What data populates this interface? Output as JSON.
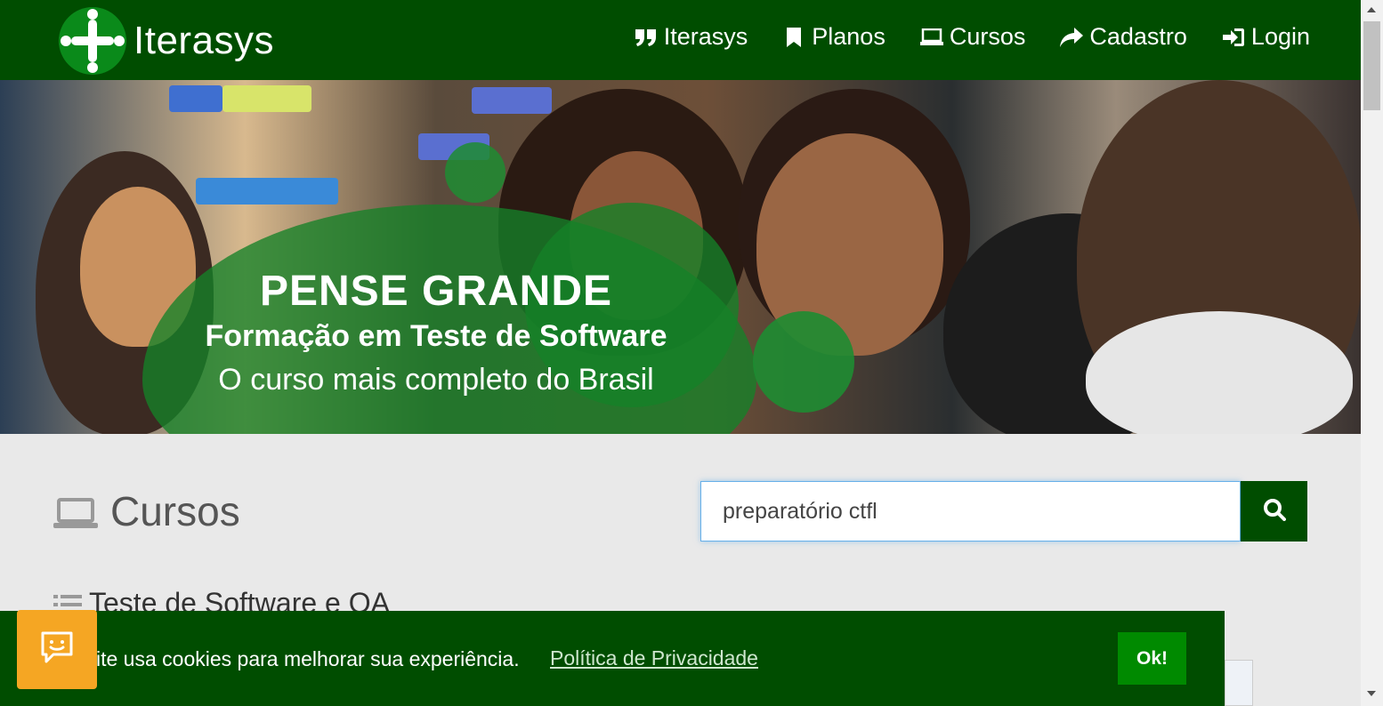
{
  "header": {
    "logo_text": "Iterasys",
    "nav": [
      {
        "label": "Iterasys",
        "icon": "quote-icon"
      },
      {
        "label": "Planos",
        "icon": "bookmark-icon"
      },
      {
        "label": "Cursos",
        "icon": "laptop-icon"
      },
      {
        "label": "Cadastro",
        "icon": "share-arrow-icon"
      },
      {
        "label": "Login",
        "icon": "sign-in-icon"
      }
    ]
  },
  "hero": {
    "title": "PENSE GRANDE",
    "subtitle": "Formação em Teste de Software",
    "tagline": "O curso mais completo do Brasil"
  },
  "main": {
    "section_title": "Cursos",
    "search": {
      "value": "preparatório ctfl",
      "placeholder": ""
    },
    "category": "Teste de Software e QA"
  },
  "cookie": {
    "text": "ite usa cookies para melhorar sua experiência.",
    "link": "Política de Privacidade",
    "ok_label": "Ok!"
  },
  "colors": {
    "brand_green": "#004d00",
    "accent_green": "#008a00",
    "chat_orange": "#f5a623"
  }
}
